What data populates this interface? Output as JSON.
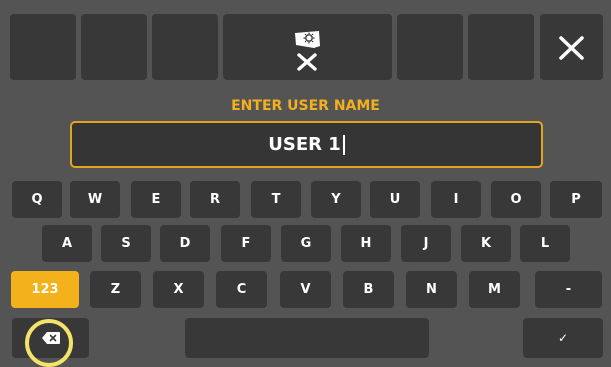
{
  "header": {
    "title": "ENTER USER NAME",
    "logo_icon": "vehicle-settings-icon",
    "close_icon": "close-icon"
  },
  "input": {
    "value": "USER 1"
  },
  "keyboard": {
    "row1": [
      "Q",
      "W",
      "E",
      "R",
      "T",
      "Y",
      "U",
      "I",
      "O",
      "P"
    ],
    "row2": [
      "A",
      "S",
      "D",
      "F",
      "G",
      "H",
      "J",
      "K",
      "L"
    ],
    "row3": [
      "123",
      "Z",
      "X",
      "C",
      "V",
      "B",
      "N",
      "M",
      "-"
    ],
    "row4": {
      "backspace_icon": "backspace-icon",
      "space": "",
      "confirm": "✓"
    }
  },
  "colors": {
    "accent": "#f3b21b",
    "background": "#545454",
    "key": "#383838"
  }
}
